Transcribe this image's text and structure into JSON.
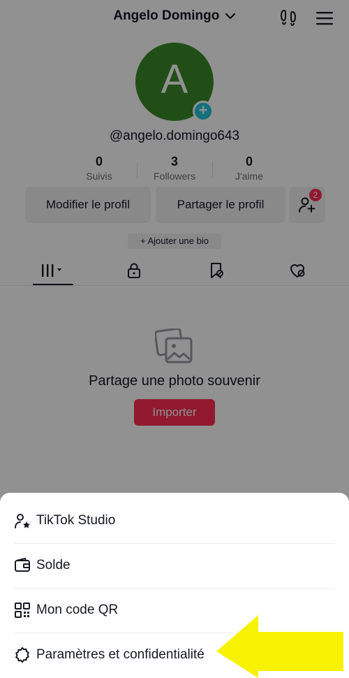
{
  "header": {
    "title": "Angelo Domingo",
    "footprints_icon": "footprints-icon",
    "menu_icon": "hamburger-menu-icon"
  },
  "profile": {
    "avatar_letter": "A",
    "avatar_color": "#3b8a2a",
    "username": "@angelo.domingo643"
  },
  "stats": [
    {
      "value": "0",
      "label": "Suivis"
    },
    {
      "value": "3",
      "label": "Followers"
    },
    {
      "value": "0",
      "label": "J'aime"
    }
  ],
  "actions": {
    "edit_profile": "Modifier le profil",
    "share_profile": "Partager le profil",
    "friends_badge": "2"
  },
  "bio_button": "+ Ajouter une bio",
  "tabs": [
    {
      "icon": "grid-icon"
    },
    {
      "icon": "lock-icon"
    },
    {
      "icon": "bookmark-icon"
    },
    {
      "icon": "liked-heart-icon"
    }
  ],
  "empty_state": {
    "icon": "photos-icon",
    "title": "Partage une photo souvenir",
    "button": "Importer"
  },
  "sheet": {
    "items": [
      {
        "label": "TikTok Studio",
        "icon": "person-star-icon"
      },
      {
        "label": "Solde",
        "icon": "wallet-icon"
      },
      {
        "label": "Mon code QR",
        "icon": "qr-code-icon"
      },
      {
        "label": "Paramètres et confidentialité",
        "icon": "settings-gear-icon"
      }
    ]
  },
  "colors": {
    "accent": "#fe2c55",
    "teal": "#20c4d8",
    "highlight_arrow": "#f7f200"
  }
}
